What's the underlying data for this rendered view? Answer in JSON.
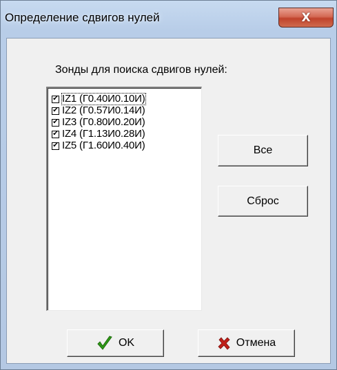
{
  "window": {
    "title": "Определение сдвигов нулей",
    "close_label": "X"
  },
  "group": {
    "label": "Зонды для поиска сдвигов нулей:"
  },
  "probes": [
    {
      "label": "IZ1  (Г0.40И0.10И)",
      "checked": true
    },
    {
      "label": "IZ2  (Г0.57И0.14И)",
      "checked": true
    },
    {
      "label": "IZ3  (Г0.80И0.20И)",
      "checked": true
    },
    {
      "label": "IZ4  (Г1.13И0.28И)",
      "checked": true
    },
    {
      "label": "IZ5  (Г1.60И0.40И)",
      "checked": true
    }
  ],
  "buttons": {
    "all": "Все",
    "reset": "Сброс",
    "ok": "OK",
    "cancel": "Отмена"
  },
  "icons": {
    "ok": "checkmark-icon",
    "cancel": "x-cross-icon"
  },
  "colors": {
    "ok_icon": "#2e9a16",
    "cancel_icon": "#c0201a",
    "close_button": "#c0432c"
  }
}
